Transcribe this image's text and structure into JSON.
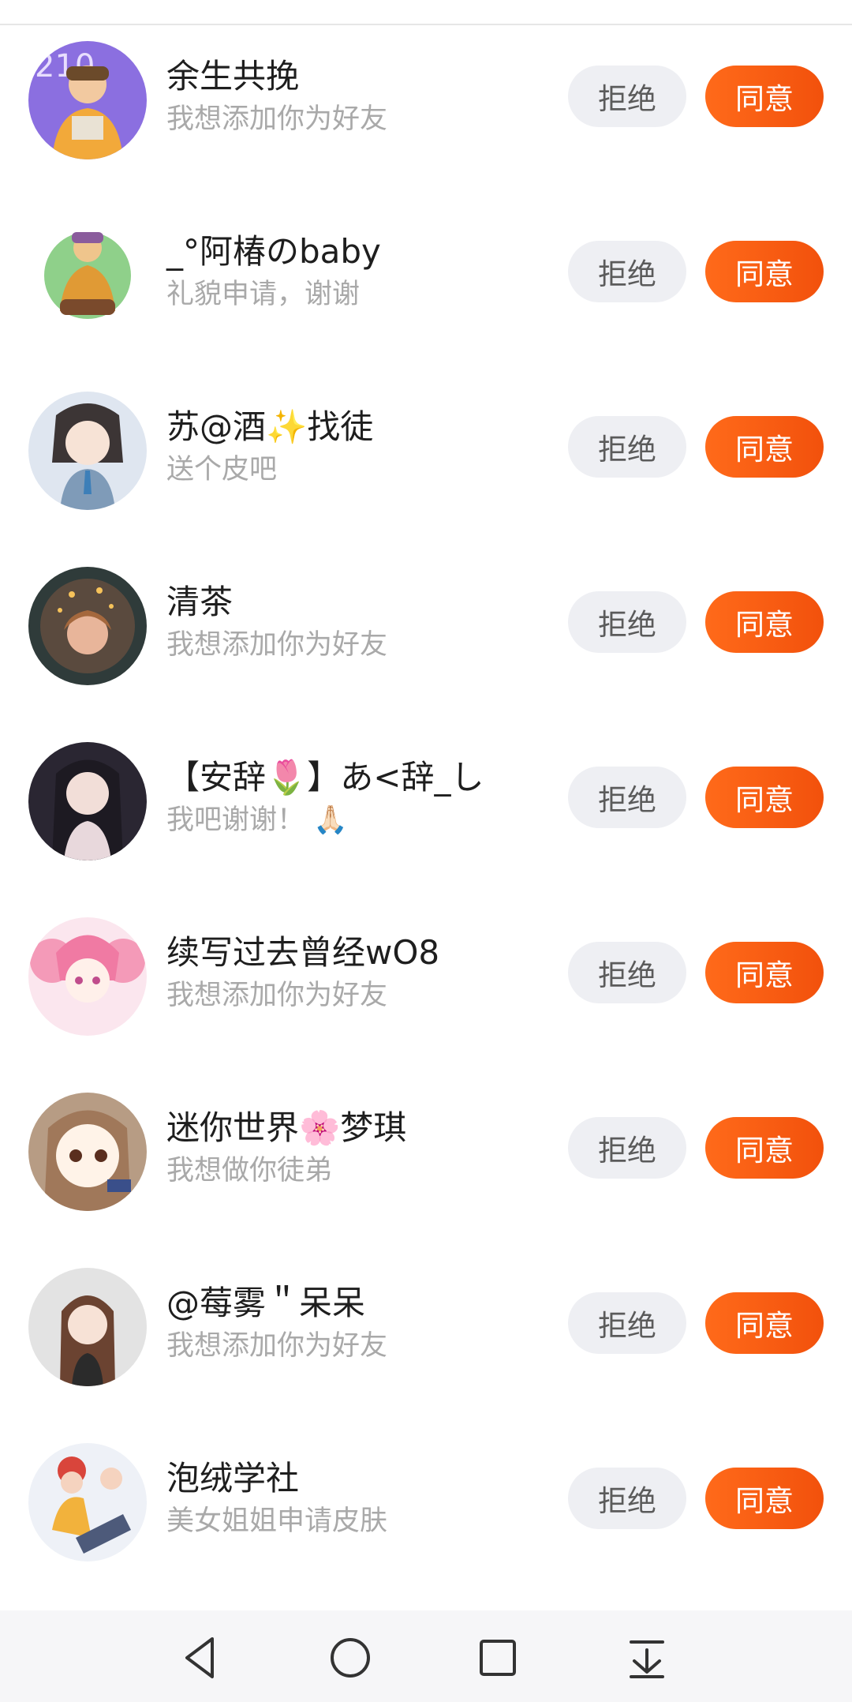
{
  "buttons": {
    "reject": "拒绝",
    "accept": "同意"
  },
  "requests": [
    {
      "name": "余生共挽",
      "message": "我想添加你为好友",
      "avatar": "avatar-boy-yellow-hoodie"
    },
    {
      "name": "_°阿椿のbaby",
      "message": "礼貌申请，谢谢",
      "avatar": "avatar-sitting-character"
    },
    {
      "name": "苏@酒✨找徒",
      "message": "送个皮吧",
      "avatar": "avatar-anime-girl-tie"
    },
    {
      "name": "清茶",
      "message": "我想添加你为好友",
      "avatar": "avatar-girl-with-stars"
    },
    {
      "name": "【安辞🌷】あ<辞_し",
      "message": "我吧谢谢！ 🙏🏻",
      "avatar": "avatar-dark-hair-girl"
    },
    {
      "name": "续写过去曾经wO8",
      "message": "我想添加你为好友",
      "avatar": "avatar-pink-hair-girl"
    },
    {
      "name": "迷你世界🌸梦琪",
      "message": "我想做你徒弟",
      "avatar": "avatar-brown-hair-chibi"
    },
    {
      "name": "@莓雾＂呆呆",
      "message": "我想添加你为好友",
      "avatar": "avatar-long-hair-girl"
    },
    {
      "name": "泡绒学社",
      "message": "美女姐姐申请皮肤",
      "avatar": "avatar-couple-illustration"
    }
  ],
  "navbar": [
    "back-icon",
    "home-icon",
    "recents-icon",
    "notification-pull-icon"
  ],
  "colors": {
    "accent": "#f55a14",
    "reject_bg": "#eeeff3"
  }
}
